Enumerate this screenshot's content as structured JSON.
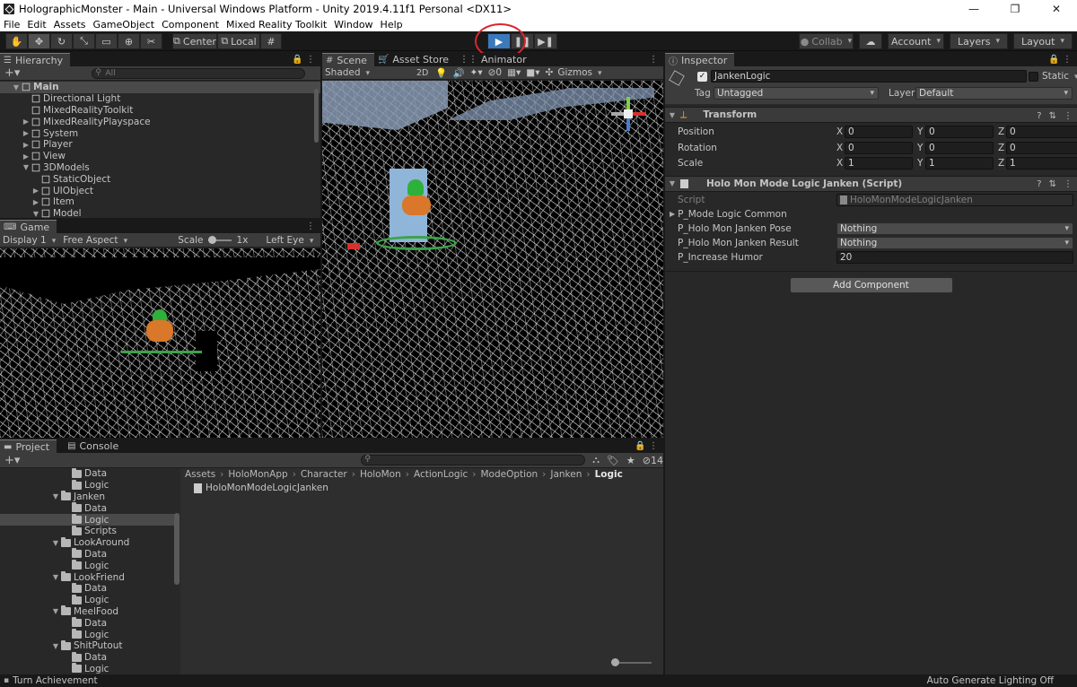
{
  "window": {
    "title": "HolographicMonster - Main - Universal Windows Platform - Unity 2019.4.11f1 Personal <DX11>"
  },
  "menu": [
    "File",
    "Edit",
    "Assets",
    "GameObject",
    "Component",
    "Mixed Reality Toolkit",
    "Window",
    "Help"
  ],
  "toolbar": {
    "pivot_label": "Center",
    "space_label": "Local",
    "collab_label": "Collab",
    "account_label": "Account",
    "layers_label": "Layers",
    "layout_label": "Layout"
  },
  "hierarchy": {
    "tab": "Hierarchy",
    "search_placeholder": "All",
    "items": [
      {
        "label": "Main",
        "indent": 0
      },
      {
        "label": "Directional Light",
        "indent": 1
      },
      {
        "label": "MixedRealityToolkit",
        "indent": 1
      },
      {
        "label": "MixedRealityPlayspace",
        "indent": 1
      },
      {
        "label": "System",
        "indent": 1
      },
      {
        "label": "Player",
        "indent": 1
      },
      {
        "label": "View",
        "indent": 1
      },
      {
        "label": "3DModels",
        "indent": 1
      },
      {
        "label": "StaticObject",
        "indent": 2
      },
      {
        "label": "UIObject",
        "indent": 2
      },
      {
        "label": "Item",
        "indent": 2
      },
      {
        "label": "Model",
        "indent": 2
      }
    ]
  },
  "game": {
    "tab": "Game",
    "display": "Display 1",
    "aspect": "Free Aspect",
    "scale_label": "Scale",
    "scale_value": "1x",
    "eye": "Left Eye"
  },
  "scene": {
    "tabs": [
      "Scene",
      "Asset Store",
      "Animator"
    ],
    "shading": "Shaded",
    "mode2d": "2D",
    "hidden_count": "0",
    "gizmos": "Gizmos"
  },
  "project": {
    "tabs": [
      "Project",
      "Console"
    ],
    "badge_count": "14",
    "breadcrumb": [
      "Assets",
      "HoloMonApp",
      "Character",
      "HoloMon",
      "ActionLogic",
      "ModeOption",
      "Janken",
      "Logic"
    ],
    "tree": [
      {
        "label": "Data",
        "indent": 2
      },
      {
        "label": "Logic",
        "indent": 2
      },
      {
        "label": "Janken",
        "indent": 1
      },
      {
        "label": "Data",
        "indent": 2
      },
      {
        "label": "Logic",
        "indent": 2
      },
      {
        "label": "Scripts",
        "indent": 2
      },
      {
        "label": "LookAround",
        "indent": 1
      },
      {
        "label": "Data",
        "indent": 2
      },
      {
        "label": "Logic",
        "indent": 2
      },
      {
        "label": "LookFriend",
        "indent": 1
      },
      {
        "label": "Data",
        "indent": 2
      },
      {
        "label": "Logic",
        "indent": 2
      },
      {
        "label": "MeelFood",
        "indent": 1
      },
      {
        "label": "Data",
        "indent": 2
      },
      {
        "label": "Logic",
        "indent": 2
      },
      {
        "label": "ShitPutout",
        "indent": 1
      },
      {
        "label": "Data",
        "indent": 2
      },
      {
        "label": "Logic",
        "indent": 2
      }
    ],
    "file": "HoloMonModeLogicJanken"
  },
  "inspector": {
    "tab": "Inspector",
    "object_name": "JankenLogic",
    "static_label": "Static",
    "tag_label": "Tag",
    "tag_value": "Untagged",
    "layer_label": "Layer",
    "layer_value": "Default",
    "transform": {
      "title": "Transform",
      "rows": [
        {
          "label": "Position",
          "x": "0",
          "y": "0",
          "z": "0"
        },
        {
          "label": "Rotation",
          "x": "0",
          "y": "0",
          "z": "0"
        },
        {
          "label": "Scale",
          "x": "1",
          "y": "1",
          "z": "1"
        }
      ]
    },
    "script": {
      "title": "Holo Mon Mode Logic Janken (Script)",
      "script_label": "Script",
      "script_value": "HoloMonModeLogicJanken",
      "common_label": "P_Mode Logic Common",
      "pose_label": "P_Holo Mon Janken Pose",
      "pose_value": "Nothing",
      "result_label": "P_Holo Mon Janken Result",
      "result_value": "Nothing",
      "humor_label": "P_Increase Humor",
      "humor_value": "20"
    },
    "add_component": "Add Component"
  },
  "status": {
    "left": "Turn Achievement",
    "right": "Auto Generate Lighting Off"
  },
  "colors": {
    "annotation_circle": "#d9262c",
    "play_active": "#3a79bb",
    "selection": "#2c5d87"
  }
}
